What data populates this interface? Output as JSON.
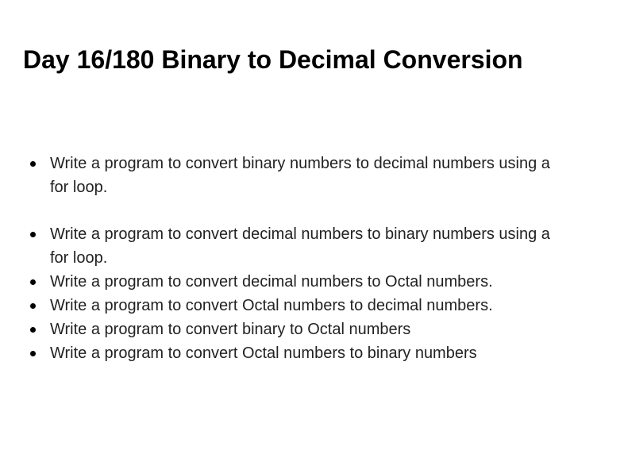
{
  "document": {
    "title": "Day 16/180 Binary to Decimal Conversion",
    "tasks": [
      {
        "text": "Write a program to convert binary numbers to decimal numbers using a for loop."
      },
      {
        "text": "Write a program to convert decimal numbers to binary numbers using a for loop."
      },
      {
        "text": "Write a program to convert decimal numbers to Octal numbers."
      },
      {
        "text": "Write a program to convert Octal numbers to decimal numbers."
      },
      {
        "text": "Write a program to convert binary to Octal numbers"
      },
      {
        "text": "Write a program to convert Octal numbers to binary numbers"
      }
    ]
  }
}
